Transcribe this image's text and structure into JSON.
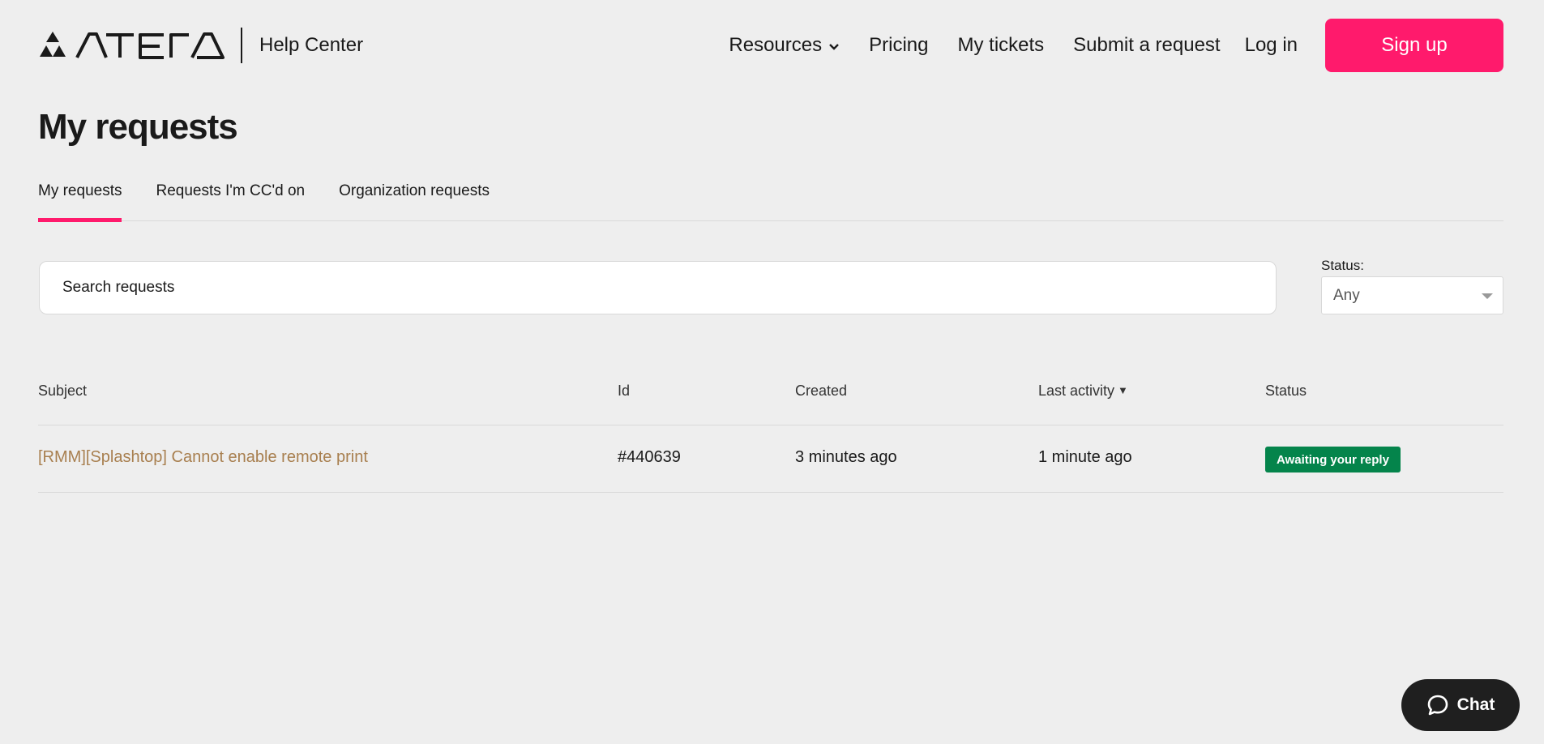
{
  "header": {
    "help_center": "Help Center",
    "nav": {
      "resources": "Resources",
      "pricing": "Pricing",
      "my_tickets": "My tickets",
      "submit_request": "Submit a request"
    },
    "login": "Log in",
    "signup": "Sign up",
    "signup_color": "#ff1a6c"
  },
  "page_title": "My requests",
  "tabs": [
    {
      "label": "My requests",
      "active": true
    },
    {
      "label": "Requests I'm CC'd on",
      "active": false
    },
    {
      "label": "Organization requests",
      "active": false
    }
  ],
  "search": {
    "placeholder": "Search requests"
  },
  "status_filter": {
    "label": "Status:",
    "selected": "Any"
  },
  "table": {
    "columns": {
      "subject": "Subject",
      "id": "Id",
      "created": "Created",
      "last_activity": "Last activity",
      "last_activity_sort": "▼",
      "status": "Status"
    },
    "rows": [
      {
        "subject": "[RMM][Splashtop] Cannot enable remote print",
        "id": "#440639",
        "created": "3 minutes ago",
        "last_activity": "1 minute ago",
        "status": "Awaiting your reply",
        "status_color": "#04844b"
      }
    ]
  },
  "chat": {
    "label": "Chat"
  },
  "icons": {
    "logo": "atera-logo-icon",
    "resources_dropdown": "chevron-down-icon",
    "status_dropdown": "caret-down-icon",
    "chat": "chat-bubble-icon"
  }
}
